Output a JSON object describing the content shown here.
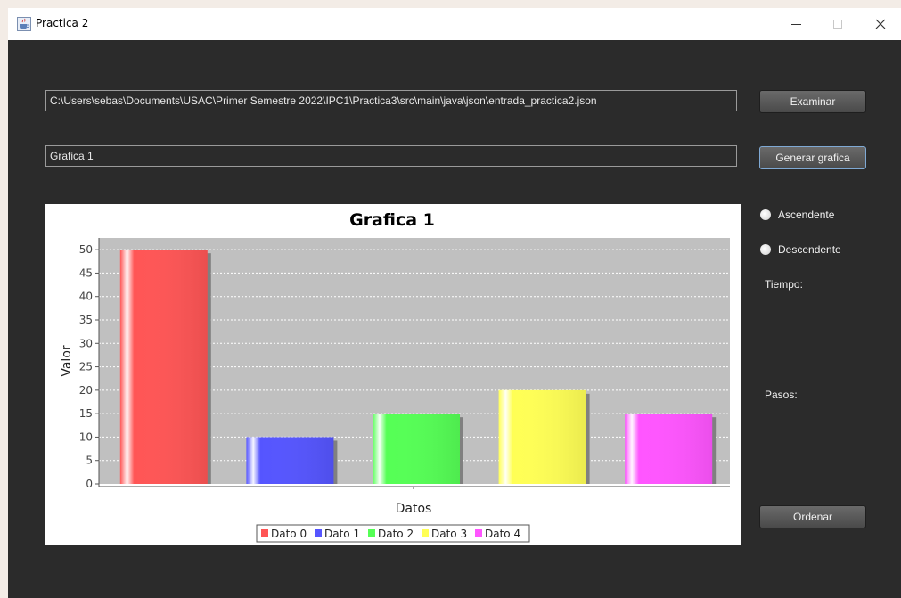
{
  "window": {
    "title": "Practica 2",
    "icon": "java-cup-icon"
  },
  "path_field": {
    "value": "C:\\Users\\sebas\\Documents\\USAC\\Primer Semestre 2022\\IPC1\\Practica3\\src\\main\\java\\json\\entrada_practica2.json"
  },
  "graph_name_field": {
    "value": "Grafica 1"
  },
  "buttons": {
    "examinar": "Examinar",
    "generar": "Generar grafica",
    "ordenar": "Ordenar"
  },
  "sort_options": {
    "ascendente": "Ascendente",
    "descendente": "Descendente"
  },
  "info": {
    "tiempo": "Tiempo:",
    "pasos": "Pasos:"
  },
  "chart_data": {
    "type": "bar",
    "title": "Grafica 1",
    "xlabel": "Datos",
    "ylabel": "Valor",
    "ylim": [
      0,
      52.5
    ],
    "yticks": [
      0,
      5,
      10,
      15,
      20,
      25,
      30,
      35,
      40,
      45,
      50
    ],
    "series": [
      {
        "name": "Dato 0",
        "value": 50,
        "color": "#ff5555"
      },
      {
        "name": "Dato 1",
        "value": 10,
        "color": "#5555ff"
      },
      {
        "name": "Dato 2",
        "value": 15,
        "color": "#55ff55"
      },
      {
        "name": "Dato 3",
        "value": 20,
        "color": "#ffff55"
      },
      {
        "name": "Dato 4",
        "value": 15,
        "color": "#ff55ff"
      }
    ],
    "legend_position": "bottom",
    "grid": true,
    "plot_background": "#c0c0c0"
  }
}
